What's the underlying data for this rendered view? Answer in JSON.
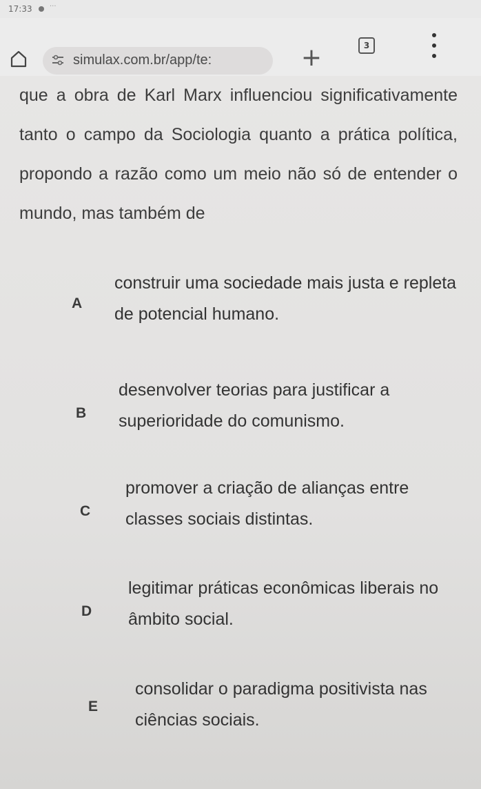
{
  "status_bar": {
    "time": "17:33",
    "extra": "···"
  },
  "browser": {
    "url": "simulax.com.br/app/te:",
    "new_tab": "+",
    "tab_count": "3"
  },
  "question": {
    "text": "que a obra de Karl Marx influenciou significativamente tanto o campo da Sociologia quanto a prática política, propondo a razão como um meio não só de entender o mundo, mas também de"
  },
  "options": [
    {
      "letter": "A",
      "text": "construir uma sociedade mais justa e repleta de potencial humano."
    },
    {
      "letter": "B",
      "text": "desenvolver teorias para justificar a superioridade do comunismo."
    },
    {
      "letter": "C",
      "text": "promover a criação de alianças entre classes sociais distintas."
    },
    {
      "letter": "D",
      "text": "legitimar práticas econômicas liberais no âmbito social."
    },
    {
      "letter": "E",
      "text": "consolidar o paradigma positivista nas ciências sociais."
    }
  ],
  "icons": {
    "home": "home-icon",
    "site": "site-settings-icon",
    "menu": "more-vert-icon"
  }
}
